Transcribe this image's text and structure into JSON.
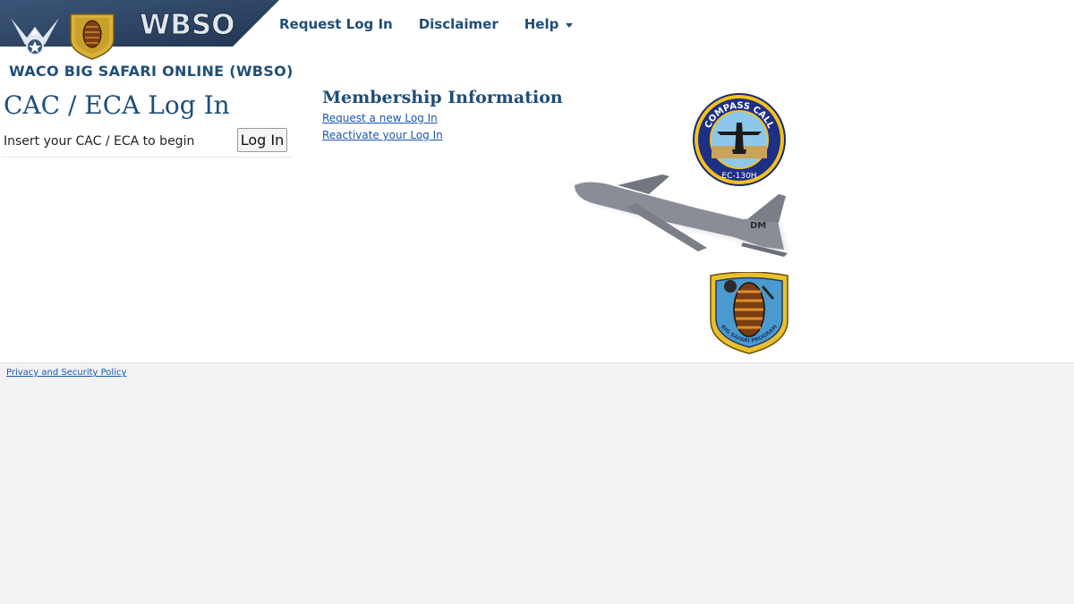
{
  "header": {
    "logo_text": "WBSO",
    "banner_color": "#2d4363",
    "nav": {
      "request_login": "Request Log In",
      "disclaimer": "Disclaimer",
      "help": "Help"
    }
  },
  "site_title": "WACO BIG SAFARI ONLINE (WBSO)",
  "login": {
    "heading": "CAC / ECA Log In",
    "instruction": "Insert your CAC / ECA to begin",
    "button_label": "Log In"
  },
  "membership": {
    "heading": "Membership Information",
    "links": [
      "Request a new Log In",
      "Reactivate your Log In"
    ]
  },
  "images": {
    "compass_call_patch": {
      "top_text": "COMPASS CALL",
      "bottom_text": "EC-130H"
    },
    "aircraft_tail_code": "DM",
    "big_safari_patch": {
      "text": "BIG SAFARI PROGRAM"
    }
  },
  "footer": {
    "privacy_link": "Privacy and Security Policy"
  },
  "colors": {
    "heading_blue": "#1f4e79",
    "link_blue": "#1a56b0",
    "page_bg": "#f2f2f2"
  }
}
